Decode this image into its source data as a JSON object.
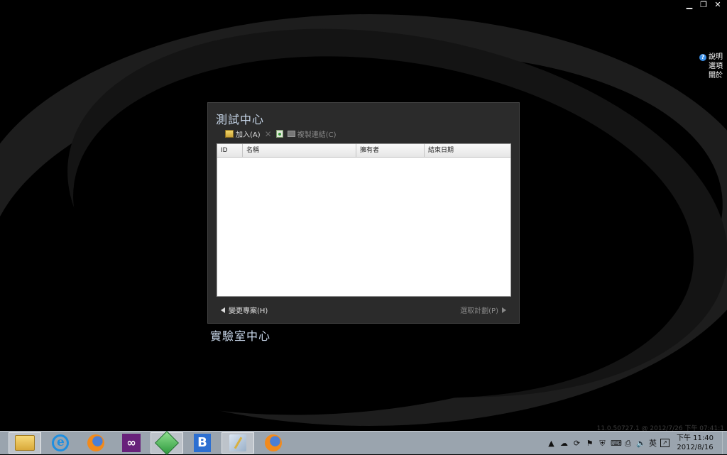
{
  "window_controls": {
    "minimize": "▁",
    "restore": "❐",
    "close": "✕"
  },
  "side_menu": {
    "help": "說明",
    "options": "選項",
    "about": "關於"
  },
  "panel": {
    "title": "測試中心",
    "toolbar": {
      "add": "加入(A)",
      "copy_link": "複製連結(C)"
    },
    "grid_columns": [
      "ID",
      "名稱",
      "擁有者",
      "結束日期"
    ],
    "back_button": "變更專案(H)",
    "next_button": "選取計劃(P)"
  },
  "lab_center": "實驗室中心",
  "version_text": "11.0.50727.1 @ 2012/7/26 下午 07:41:1",
  "taskbar": {
    "apps": [
      "File Explorer",
      "Internet Explorer",
      "Firefox",
      "Visual Studio",
      "Microsoft Test Manager",
      "Bing",
      "Paint",
      "Firefox"
    ],
    "ime": "英",
    "time": "下午 11:40",
    "date": "2012/8/16"
  },
  "icons": {
    "help": "question-icon",
    "add": "add-icon",
    "delete": "delete-icon",
    "refresh": "refresh-icon",
    "copy": "copy-icon"
  }
}
